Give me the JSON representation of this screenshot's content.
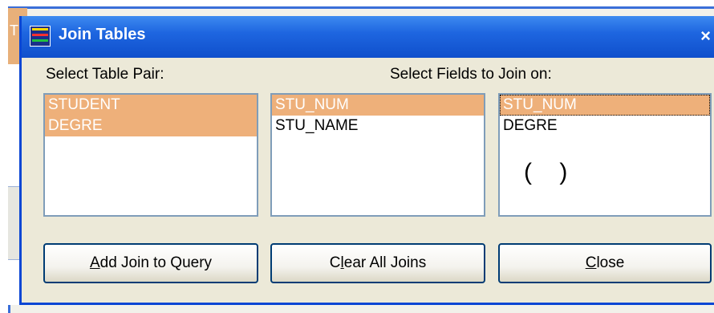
{
  "dialog": {
    "title": "Join Tables",
    "close_glyph": "×",
    "icon": "app-data-icon"
  },
  "background_window": {
    "title_fragment": "T"
  },
  "labels": {
    "table_pair": "Select Table Pair:",
    "fields": "Select Fields to Join on:"
  },
  "table_pair_list": {
    "items": [
      {
        "label": "STUDENT",
        "selected": true
      },
      {
        "label": "DEGRE",
        "selected": true
      }
    ]
  },
  "left_fields_list": {
    "items": [
      {
        "label": "STU_NUM",
        "selected": true
      },
      {
        "label": "STU_NAME",
        "selected": false
      }
    ]
  },
  "right_fields_list": {
    "items": [
      {
        "label": "STU_NUM",
        "selected": true,
        "focused": true
      },
      {
        "label": "DEGRE",
        "selected": false
      }
    ],
    "annotation": "(   )"
  },
  "buttons": {
    "add_join": {
      "accel": "A",
      "rest": "dd Join to Query"
    },
    "clear_joins": {
      "accel": "l",
      "pre": "C",
      "rest": "ear All Joins"
    },
    "close": {
      "accel": "C",
      "rest": "lose"
    }
  },
  "colors": {
    "titlebar": "#1e66e0",
    "selection": "#eeb07a",
    "dialog_bg": "#ece9d8"
  }
}
